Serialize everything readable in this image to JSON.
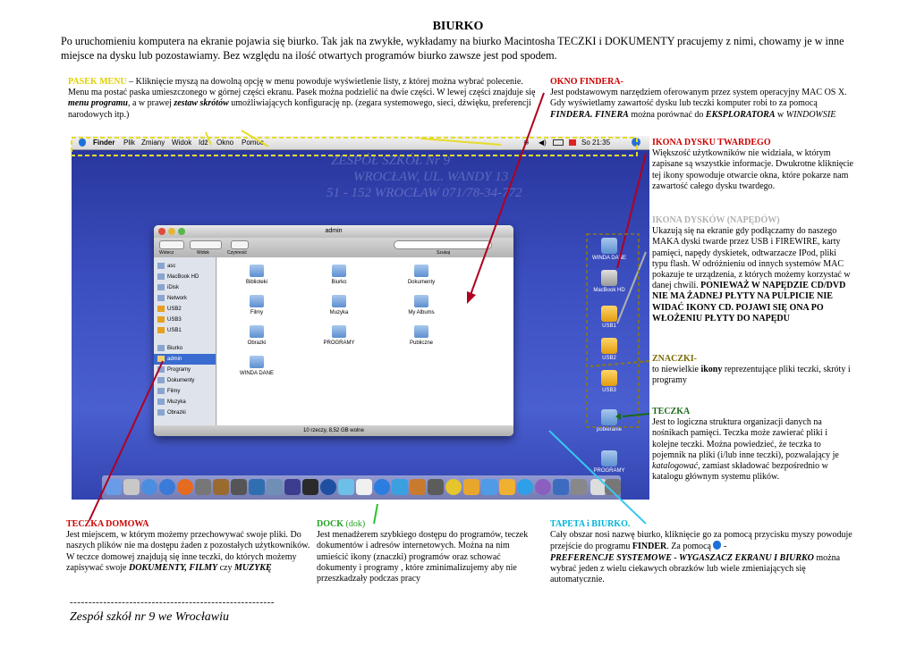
{
  "title": "BIURKO",
  "intro": "Po uruchomieniu komputera na ekranie pojawia się biurko.  Tak jak na zwykłe, wykładamy na biurko Macintosha TECZKI i DOKUMENTY pracujemy z nimi, chowamy je w inne miejsce na dysku lub pozostawiamy. Bez względu na ilość otwartych programów biurko zawsze jest pod spodem.",
  "pasek": {
    "heading": "PASEK MENU",
    "line1": " – Kliknięcie myszą na dowolną opcję w menu powoduje wyświetlenie listy, z której można wybrać polecenie.",
    "line2a": "Menu ma postać paska umieszczonego w górnej części ekranu. Pasek można podzielić na dwie części. W lewej części znajduje się ",
    "menu_programu": "menu programu",
    "line2b": ", a w prawej ",
    "zestaw_skrotow": "zestaw skrótów",
    "line2c": " umożliwiających konfigurację np. (zegara systemowego, sieci, dźwięku, preferencji narodowych itp.)"
  },
  "okno": {
    "heading": "OKNO FINDERA-",
    "text1": "Jest podstawowym narzędziem oferowanym przez system operacyjny MAC OS X. Gdy wyświetlamy zawartość dysku lub teczki komputer robi to za pomocą ",
    "findera": "FINDERA. FINERA",
    "text2": " można porównać do ",
    "eksploratora": "EKSPLORATORA",
    "text3": " w ",
    "windowsie": "WINDOWSIE"
  },
  "ikona_dysku": {
    "heading": "IKONA DYSKU TWARDEGO",
    "text": "Większość użytkowników nie widziała, w którym zapisane są wszystkie informacje. Dwukrotne kliknięcie tej ikony spowoduje otwarcie okna, które pokarze nam zawartość całego dysku twardego."
  },
  "ikona_dyskow": {
    "heading": "IKONA DYSKÓW (NAPĘDÓW)",
    "text": "Ukazują się na ekranie gdy podłączamy do naszego MAKA dyski twarde przez USB i FIREWIRE, karty pamięci, napędy dyskietek, odtwarzacze IPod, pliki typu flash. W odróżnieniu od innych systemów MAC pokazuje te urządzenia, z których możemy korzystać w danej chwili. ",
    "bold": "PONIEWAŻ W NAPĘDZIE CD/DVD NIE MA ŻADNEJ  PŁYTY NA PULPICIE  NIE WIDAĆ IKONY CD. POJAWI SIĘ ONA PO WŁOŻENIU PŁYTY DO NAPĘDU"
  },
  "znaczki": {
    "heading": "ZNACZKI-",
    "text1": "to niewielkie ",
    "ikony": "ikony",
    "text2": " reprezentujące pliki teczki, skróty i programy"
  },
  "teczka": {
    "heading": "TECZKA",
    "text1": "Jest to logiczna struktura organizacji danych na nośnikach pamięci. Teczka może zawierać pliki  i kolejne teczki. Można powiedzieć, że teczka to pojemnik na pliki (i/lub inne teczki), pozwalający je ",
    "katalogowac": "katalogować",
    "text2": ", zamiast składować bezpośrednio w katalogu głównym systemu plików."
  },
  "teczka_domowa": {
    "heading": "TECZKA DOMOWA",
    "text1": "Jest miejscem, w którym możemy przechowywać swoje pliki. Do naszych plików nie ma dostępu żaden z pozostałych użytkowników. W teczce domowej znajdują się inne teczki, do których możemy zapisywać swoje ",
    "bold": "DOKUMENTY, FILMY",
    "text2": " czy ",
    "muzyke": "MUZYKĘ"
  },
  "dock": {
    "heading": "DOCK",
    "heading2": " (dok)",
    "text": "Jest menadżerem szybkiego dostępu do programów, teczek dokumentów i adresów internetowych. Można na nim umieścić ikony (znaczki) programów oraz schować dokumenty i programy , które zminimalizujemy aby nie przeszkadzały podczas pracy"
  },
  "tapeta": {
    "heading": "TAPETA i BIURKO.",
    "text1": "Cały obszar nosi nazwę biurko, kliknięcie go za pomocą przycisku myszy powoduje przejście do programu ",
    "finder": "FINDER",
    "text2": ". Za pomocą ",
    "text3": " -",
    "bold": "PREFERENCJE SYSTEMOWE - WYGASZACZ EKRANU I BIURKO",
    "text4": " można wybrać jeden z wielu ciekawych obrazków lub wiele zmieniających się automatycznie."
  },
  "footer": {
    "line": "-------------------------------------------------------",
    "school": "Zespół szkół nr 9 we Wrocławiu"
  },
  "screenshot": {
    "menubar": [
      "Finder",
      "Plik",
      "Zmiany",
      "Widok",
      "Idź",
      "Okno",
      "Pomoc"
    ],
    "clock": "So 21:35",
    "watermark": [
      "ZESPÓŁ SZKÓŁ Nr 9",
      "WROCŁAW, UL. WANDY 13",
      "51 - 152 WROCŁAW  071/78-34-772"
    ],
    "finder_title": "admin",
    "toolbar_labels": [
      "Wstecz",
      "Widok",
      "Czynność",
      "Szukaj"
    ],
    "sidebar": [
      "asc",
      "MacBook HD",
      "iDisk",
      "Network",
      "USB2",
      "USB3",
      "USB1",
      "Biurko",
      "admin",
      "Programy",
      "Dokumenty",
      "Filmy",
      "Muzyka",
      "Obrazki"
    ],
    "folders": [
      "Biblioteki",
      "Biurko",
      "Dokumenty",
      "Filmy",
      "Muzyka",
      "My Albums",
      "Obrazki",
      "PROGRAMY",
      "Publiczne",
      "WINDA DANE"
    ],
    "status": "10 rzeczy, 8,52 GB wolne",
    "desktop_icons": [
      "WINDA DANE",
      "MacBook HD",
      "USB1",
      "USB2",
      "USB3",
      "pobieranie",
      "PROGRAMY"
    ]
  }
}
